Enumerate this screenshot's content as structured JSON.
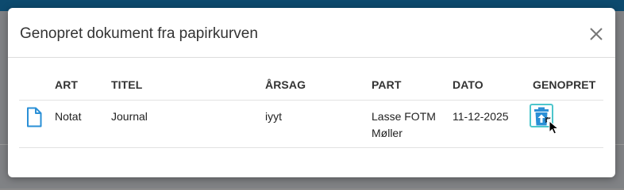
{
  "modal": {
    "title": "Genopret dokument fra papirkurven"
  },
  "table": {
    "columns": [
      "ART",
      "TITEL",
      "ÅRSAG",
      "PART",
      "DATO",
      "GENOPRET"
    ],
    "rows": [
      {
        "icon": "document-icon",
        "art": "Notat",
        "titel": "Journal",
        "aarsag": "iyyt",
        "part": "Lasse FOTM Møller",
        "dato": "11-12-2025",
        "restore_icon": "restore-trash-icon"
      }
    ]
  },
  "colors": {
    "header_bar": "#0d4a6e",
    "accent": "#2a8fd6",
    "restore_border": "#4dc6cc"
  }
}
